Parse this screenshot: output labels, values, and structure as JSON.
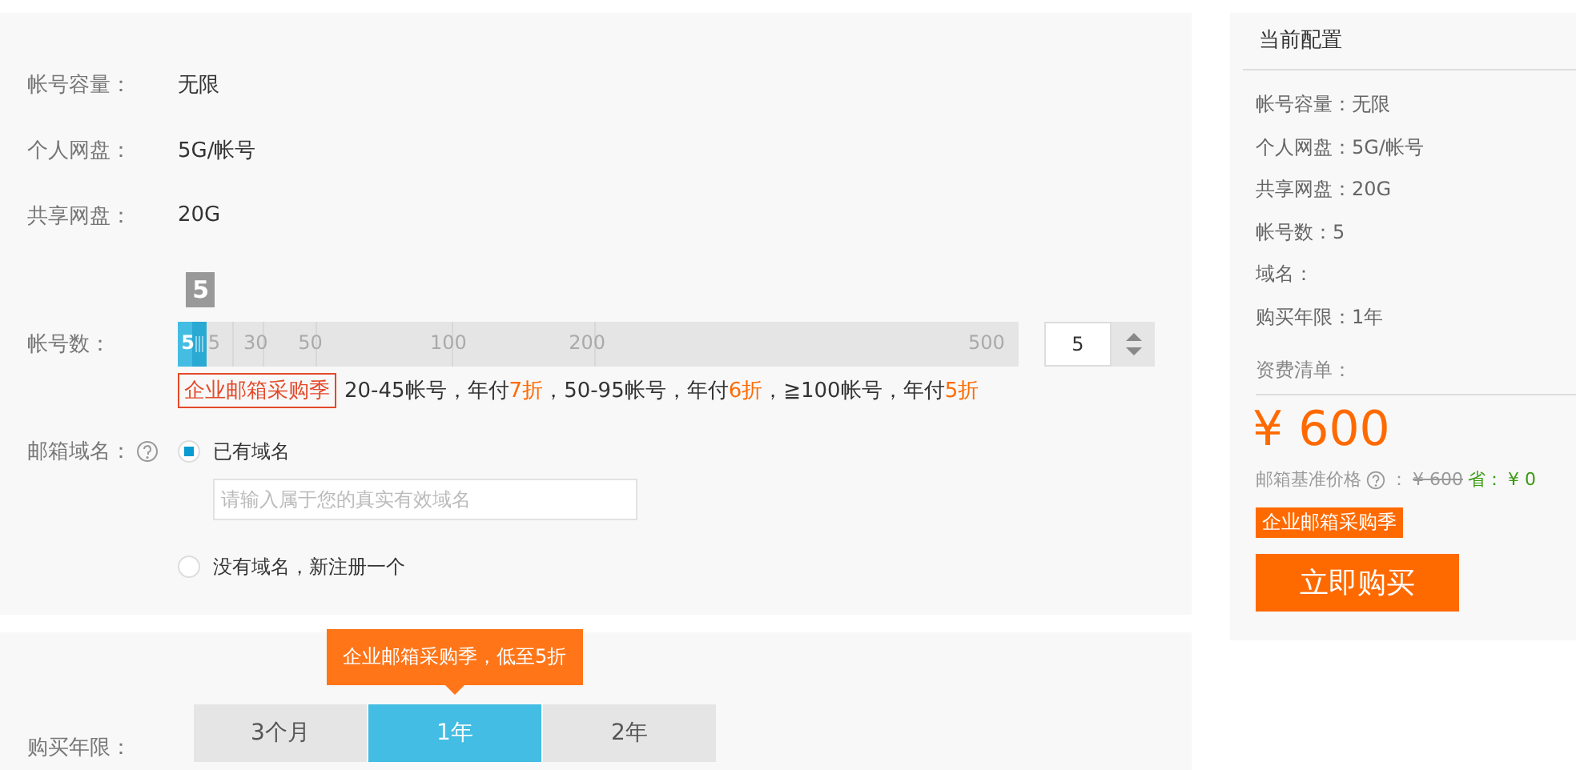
{
  "config": {
    "rows": [
      {
        "label": "帐号容量：",
        "value": "无限"
      },
      {
        "label": "个人网盘：",
        "value": "5G/帐号"
      },
      {
        "label": "共享网盘：",
        "value": "20G"
      }
    ],
    "accounts": {
      "label": "帐号数：",
      "tooltip": "5",
      "level": 0.035,
      "ticks": [
        "5",
        "5",
        "30",
        "50",
        "100",
        "200",
        "500"
      ],
      "value": "5"
    },
    "promo": {
      "tag": "企业邮箱采购季",
      "parts": [
        {
          "text": "20-45帐号，年付",
          "highlight": false
        },
        {
          "text": "7折",
          "highlight": true
        },
        {
          "text": "，50-95帐号，年付",
          "highlight": false
        },
        {
          "text": "6折",
          "highlight": true
        },
        {
          "text": "，≧100帐号，年付",
          "highlight": false
        },
        {
          "text": "5折",
          "highlight": true
        }
      ]
    },
    "domain": {
      "label": "邮箱域名：",
      "options": [
        {
          "label": "已有域名",
          "selected": true
        },
        {
          "label": "没有域名，新注册一个",
          "selected": false
        }
      ],
      "placeholder": "请输入属于您的真实有效域名"
    }
  },
  "period": {
    "label": "购买年限：",
    "tooltip": "企业邮箱采购季，低至5折",
    "tabs": [
      {
        "label": "3个月",
        "selected": false
      },
      {
        "label": "1年",
        "selected": true
      },
      {
        "label": "2年",
        "selected": false
      }
    ]
  },
  "summary": {
    "title": "当前配置",
    "items": [
      "帐号容量：无限",
      "个人网盘：5G/帐号",
      "共享网盘：20G",
      "帐号数：5",
      "域名：",
      "购买年限：1年"
    ],
    "bill_label": "资费清单：",
    "price": "¥ 600",
    "base_label": "邮箱基准价格",
    "base_sep": "：",
    "base_price": "¥ 600",
    "save_label": "省：",
    "save_value": "¥ 0",
    "tag": "企业邮箱采购季",
    "buy": "立即购买"
  }
}
